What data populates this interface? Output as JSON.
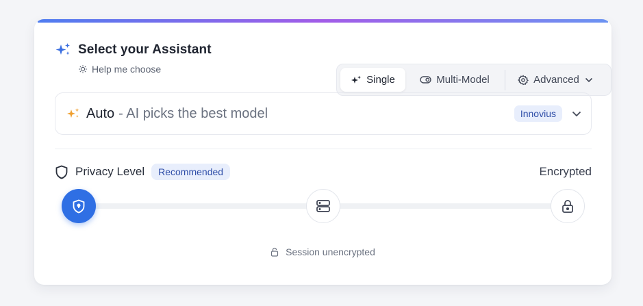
{
  "header": {
    "title": "Select your Assistant",
    "help_link": "Help me choose"
  },
  "modes": {
    "single_label": "Single",
    "multi_label": "Multi-Model",
    "advanced_label": "Advanced",
    "selected": "Single"
  },
  "model": {
    "name": "Auto",
    "description": "- AI picks the best model",
    "provider": "Innovius"
  },
  "privacy": {
    "label": "Privacy Level",
    "badge": "Recommended",
    "current_level": "Encrypted",
    "levels": [
      "shield",
      "server",
      "lock"
    ],
    "selected_index": 0,
    "session_status": "Session unencrypted"
  },
  "colors": {
    "accent": "#2f6fe4",
    "badge_bg": "#e8eefc",
    "sparkle_blue": "#3b6fe0",
    "sparkle_orange": "#f0a030"
  }
}
